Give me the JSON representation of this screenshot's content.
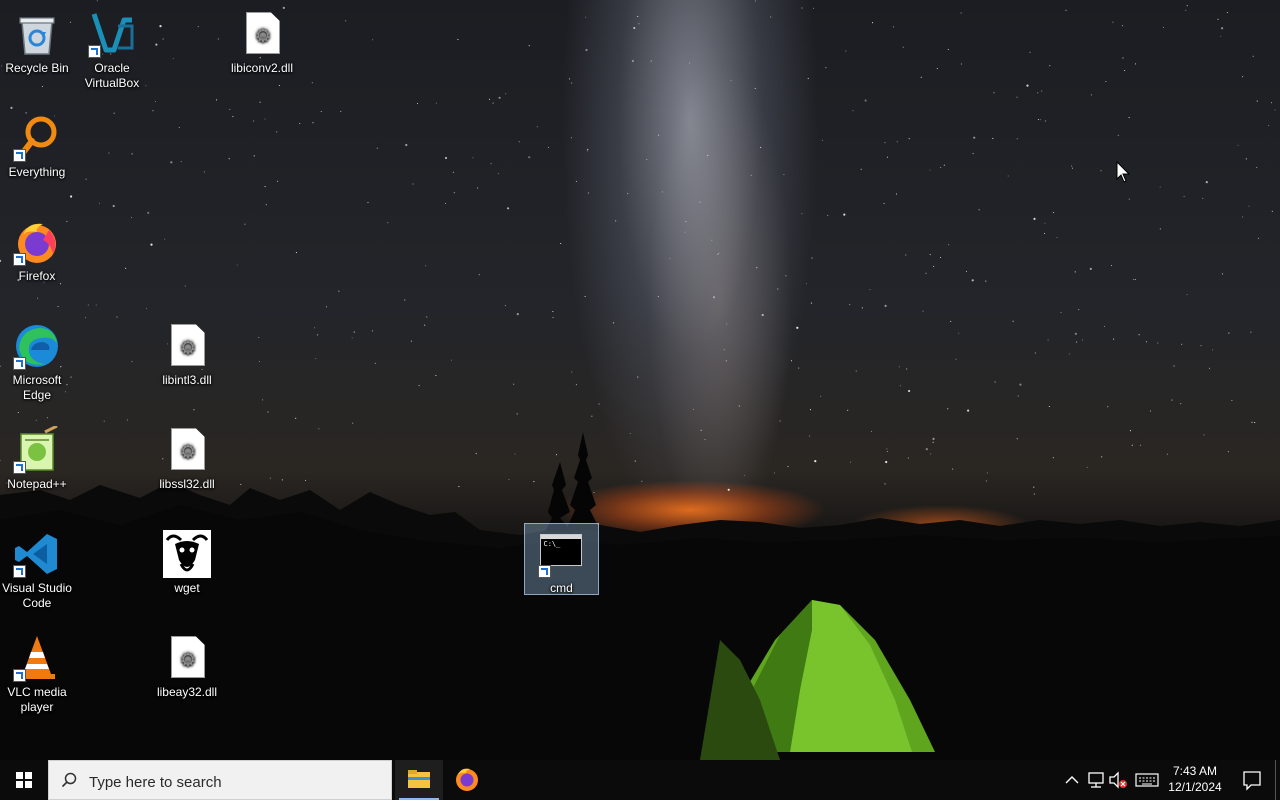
{
  "desktop": {
    "icons": [
      {
        "label": "Recycle Bin"
      },
      {
        "label": "Oracle VirtualBox"
      },
      {
        "label": "libiconv2.dll"
      },
      {
        "label": "Everything"
      },
      {
        "label": "Firefox"
      },
      {
        "label": "Microsoft Edge"
      },
      {
        "label": "libintl3.dll"
      },
      {
        "label": "Notepad++"
      },
      {
        "label": "libssl32.dll"
      },
      {
        "label": "Visual Studio Code"
      },
      {
        "label": "wget"
      },
      {
        "label": "cmd"
      },
      {
        "label": "VLC media player"
      },
      {
        "label": "libeay32.dll"
      }
    ],
    "cmd_icon_text": "C:\\_"
  },
  "taskbar": {
    "search_placeholder": "Type here to search",
    "pinned_apps": [
      {
        "icon": "file-explorer-icon",
        "active": true
      },
      {
        "icon": "firefox-icon",
        "active": false
      }
    ],
    "tray": {
      "icons": [
        "chevron-up-icon",
        "network-icon",
        "volume-muted-icon",
        "keyboard-icon"
      ]
    },
    "clock": {
      "time": "7:43 AM",
      "date": "12/1/2024"
    }
  },
  "colors": {
    "taskbar_bg": "#0b0b0c",
    "selection": "#a0c8f0",
    "accent": "#1e6fd0"
  }
}
